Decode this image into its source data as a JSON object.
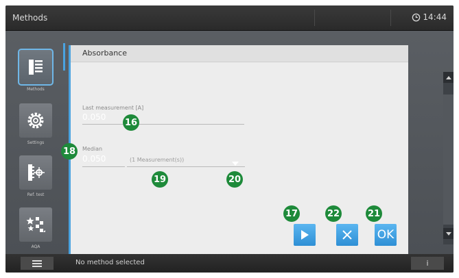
{
  "header": {
    "title": "Methods",
    "time": "14:44"
  },
  "sidebar": {
    "items": [
      {
        "label": "Methods"
      },
      {
        "label": "Settings"
      },
      {
        "label": "Ref. test"
      },
      {
        "label": "AQA"
      }
    ]
  },
  "panel": {
    "title": "Absorbance",
    "last_measurement_label": "Last measurement [A]",
    "last_measurement_value": "0.050",
    "median_label": "Median",
    "median_value": "0.050",
    "median_count": "(1 Measurement(s))"
  },
  "markers": {
    "m16": "16",
    "m17": "17",
    "m18": "18",
    "m19": "19",
    "m20": "20",
    "m21": "21",
    "m22": "22"
  },
  "buttons": {
    "ok_label": "OK"
  },
  "footer": {
    "status": "No method selected",
    "info_label": "i"
  },
  "colors": {
    "accent": "#4aa3e0",
    "marker": "#1e8a3a",
    "button": "#3a9ee0"
  }
}
